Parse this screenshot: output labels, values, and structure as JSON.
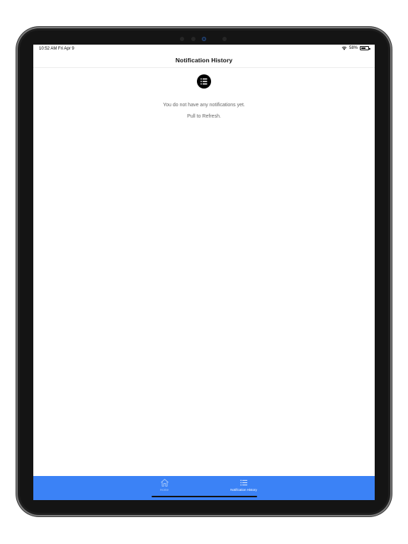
{
  "status_bar": {
    "time_date": "10:52 AM  Fri Apr 9",
    "battery_percent": "58%",
    "battery_level": 0.58
  },
  "nav": {
    "title": "Notification History"
  },
  "empty_state": {
    "icon": "list-circle-icon",
    "message": "You do not have any notifications yet.",
    "hint": "Pull to Refresh."
  },
  "tab_bar": {
    "background": "#3b82f6",
    "tabs": [
      {
        "label": "Home",
        "icon": "home-icon",
        "selected": false
      },
      {
        "label": "Notification History",
        "icon": "list-icon",
        "selected": true
      }
    ]
  }
}
